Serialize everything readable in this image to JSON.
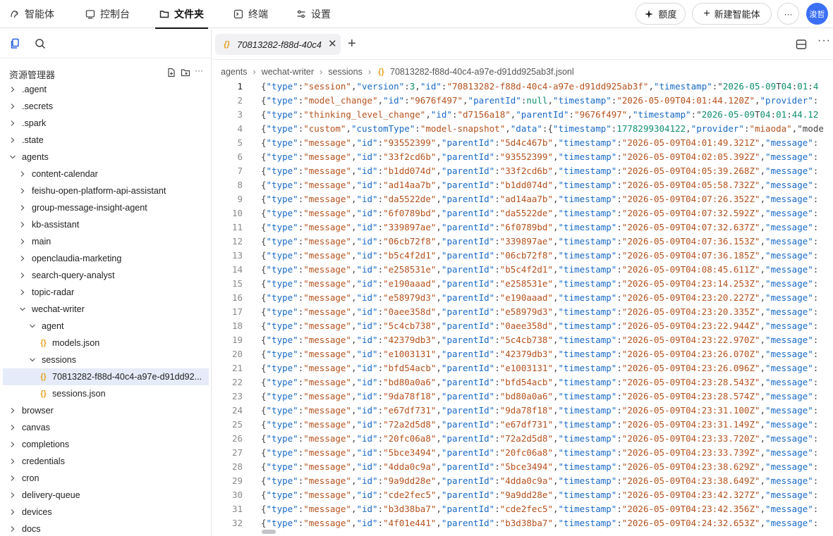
{
  "nav": {
    "tabs": [
      {
        "label": "智能体",
        "icon": "agent-icon"
      },
      {
        "label": "控制台",
        "icon": "console-icon"
      },
      {
        "label": "文件夹",
        "icon": "folder-icon",
        "active": true
      },
      {
        "label": "终端",
        "icon": "terminal-icon"
      },
      {
        "label": "设置",
        "icon": "settings-icon"
      }
    ],
    "quota_label": "额度",
    "new_agent_label": "新建智能体",
    "more_label": "···",
    "avatar_text": "浚哲"
  },
  "explorer": {
    "title": "资源管理器",
    "tree": [
      {
        "label": ".agent",
        "type": "folder",
        "depth": 0,
        "expanded": false
      },
      {
        "label": ".secrets",
        "type": "folder",
        "depth": 0,
        "expanded": false
      },
      {
        "label": ".spark",
        "type": "folder",
        "depth": 0,
        "expanded": false
      },
      {
        "label": ".state",
        "type": "folder",
        "depth": 0,
        "expanded": false
      },
      {
        "label": "agents",
        "type": "folder",
        "depth": 0,
        "expanded": true
      },
      {
        "label": "content-calendar",
        "type": "folder",
        "depth": 1,
        "expanded": false
      },
      {
        "label": "feishu-open-platform-api-assistant",
        "type": "folder",
        "depth": 1,
        "expanded": false
      },
      {
        "label": "group-message-insight-agent",
        "type": "folder",
        "depth": 1,
        "expanded": false
      },
      {
        "label": "kb-assistant",
        "type": "folder",
        "depth": 1,
        "expanded": false
      },
      {
        "label": "main",
        "type": "folder",
        "depth": 1,
        "expanded": false
      },
      {
        "label": "openclaudia-marketing",
        "type": "folder",
        "depth": 1,
        "expanded": false
      },
      {
        "label": "search-query-analyst",
        "type": "folder",
        "depth": 1,
        "expanded": false
      },
      {
        "label": "topic-radar",
        "type": "folder",
        "depth": 1,
        "expanded": false
      },
      {
        "label": "wechat-writer",
        "type": "folder",
        "depth": 1,
        "expanded": true
      },
      {
        "label": "agent",
        "type": "folder",
        "depth": 2,
        "expanded": true
      },
      {
        "label": "models.json",
        "type": "file",
        "depth": 3
      },
      {
        "label": "sessions",
        "type": "folder",
        "depth": 2,
        "expanded": true
      },
      {
        "label": "70813282-f88d-40c4-a97e-d91dd92...",
        "type": "file",
        "depth": 3,
        "selected": true
      },
      {
        "label": "sessions.json",
        "type": "file",
        "depth": 3
      },
      {
        "label": "browser",
        "type": "folder",
        "depth": 0,
        "expanded": false
      },
      {
        "label": "canvas",
        "type": "folder",
        "depth": 0,
        "expanded": false
      },
      {
        "label": "completions",
        "type": "folder",
        "depth": 0,
        "expanded": false
      },
      {
        "label": "credentials",
        "type": "folder",
        "depth": 0,
        "expanded": false
      },
      {
        "label": "cron",
        "type": "folder",
        "depth": 0,
        "expanded": false
      },
      {
        "label": "delivery-queue",
        "type": "folder",
        "depth": 0,
        "expanded": false
      },
      {
        "label": "devices",
        "type": "folder",
        "depth": 0,
        "expanded": false
      },
      {
        "label": "docs",
        "type": "folder",
        "depth": 0,
        "expanded": false
      }
    ]
  },
  "editor": {
    "tab_label": "70813282-f88d-40c4",
    "close_label": "✕",
    "add_label": "+",
    "more_label": "···",
    "breadcrumb": [
      "agents",
      "wechat-writer",
      "sessions",
      "70813282-f88d-40c4-a97e-d91dd925ab3f.jsonl"
    ],
    "lines": [
      "{\"type\":\"session\",\"version\":3,\"id\":\"70813282-f88d-40c4-a97e-d91dd925ab3f\",\"timestamp\":\"2026-05-09T04:01:4",
      "{\"type\":\"model_change\",\"id\":\"9676f497\",\"parentId\":null,\"timestamp\":\"2026-05-09T04:01:44.120Z\",\"provider\":",
      "{\"type\":\"thinking_level_change\",\"id\":\"d7156a18\",\"parentId\":\"9676f497\",\"timestamp\":\"2026-05-09T04:01:44.12",
      "{\"type\":\"custom\",\"customType\":\"model-snapshot\",\"data\":{\"timestamp\":1778299304122,\"provider\":\"miaoda\",\"mode",
      "{\"type\":\"message\",\"id\":\"93552399\",\"parentId\":\"5d4c467b\",\"timestamp\":\"2026-05-09T04:01:49.321Z\",\"message\":",
      "{\"type\":\"message\",\"id\":\"33f2cd6b\",\"parentId\":\"93552399\",\"timestamp\":\"2026-05-09T04:02:05.392Z\",\"message\":",
      "{\"type\":\"message\",\"id\":\"b1dd074d\",\"parentId\":\"33f2cd6b\",\"timestamp\":\"2026-05-09T04:05:39.268Z\",\"message\":",
      "{\"type\":\"message\",\"id\":\"ad14aa7b\",\"parentId\":\"b1dd074d\",\"timestamp\":\"2026-05-09T04:05:58.732Z\",\"message\":",
      "{\"type\":\"message\",\"id\":\"da5522de\",\"parentId\":\"ad14aa7b\",\"timestamp\":\"2026-05-09T04:07:26.352Z\",\"message\":",
      "{\"type\":\"message\",\"id\":\"6f0789bd\",\"parentId\":\"da5522de\",\"timestamp\":\"2026-05-09T04:07:32.592Z\",\"message\":",
      "{\"type\":\"message\",\"id\":\"339897ae\",\"parentId\":\"6f0789bd\",\"timestamp\":\"2026-05-09T04:07:32.637Z\",\"message\":",
      "{\"type\":\"message\",\"id\":\"06cb72f8\",\"parentId\":\"339897ae\",\"timestamp\":\"2026-05-09T04:07:36.153Z\",\"message\":",
      "{\"type\":\"message\",\"id\":\"b5c4f2d1\",\"parentId\":\"06cb72f8\",\"timestamp\":\"2026-05-09T04:07:36.185Z\",\"message\":",
      "{\"type\":\"message\",\"id\":\"e258531e\",\"parentId\":\"b5c4f2d1\",\"timestamp\":\"2026-05-09T04:08:45.611Z\",\"message\":",
      "{\"type\":\"message\",\"id\":\"e190aaad\",\"parentId\":\"e258531e\",\"timestamp\":\"2026-05-09T04:23:14.253Z\",\"message\":",
      "{\"type\":\"message\",\"id\":\"e58979d3\",\"parentId\":\"e190aaad\",\"timestamp\":\"2026-05-09T04:23:20.227Z\",\"message\":",
      "{\"type\":\"message\",\"id\":\"0aee358d\",\"parentId\":\"e58979d3\",\"timestamp\":\"2026-05-09T04:23:20.335Z\",\"message\":",
      "{\"type\":\"message\",\"id\":\"5c4cb738\",\"parentId\":\"0aee358d\",\"timestamp\":\"2026-05-09T04:23:22.944Z\",\"message\":",
      "{\"type\":\"message\",\"id\":\"42379db3\",\"parentId\":\"5c4cb738\",\"timestamp\":\"2026-05-09T04:23:22.970Z\",\"message\":",
      "{\"type\":\"message\",\"id\":\"e1003131\",\"parentId\":\"42379db3\",\"timestamp\":\"2026-05-09T04:23:26.070Z\",\"message\":",
      "{\"type\":\"message\",\"id\":\"bfd54acb\",\"parentId\":\"e1003131\",\"timestamp\":\"2026-05-09T04:23:26.096Z\",\"message\":",
      "{\"type\":\"message\",\"id\":\"bd80a0a6\",\"parentId\":\"bfd54acb\",\"timestamp\":\"2026-05-09T04:23:28.543Z\",\"message\":",
      "{\"type\":\"message\",\"id\":\"9da78f18\",\"parentId\":\"bd80a0a6\",\"timestamp\":\"2026-05-09T04:23:28.574Z\",\"message\":",
      "{\"type\":\"message\",\"id\":\"e67df731\",\"parentId\":\"9da78f18\",\"timestamp\":\"2026-05-09T04:23:31.100Z\",\"message\":",
      "{\"type\":\"message\",\"id\":\"72a2d5d8\",\"parentId\":\"e67df731\",\"timestamp\":\"2026-05-09T04:23:31.149Z\",\"message\":",
      "{\"type\":\"message\",\"id\":\"20fc06a8\",\"parentId\":\"72a2d5d8\",\"timestamp\":\"2026-05-09T04:23:33.720Z\",\"message\":",
      "{\"type\":\"message\",\"id\":\"5bce3494\",\"parentId\":\"20fc06a8\",\"timestamp\":\"2026-05-09T04:23:33.739Z\",\"message\":",
      "{\"type\":\"message\",\"id\":\"4dda0c9a\",\"parentId\":\"5bce3494\",\"timestamp\":\"2026-05-09T04:23:38.629Z\",\"message\":",
      "{\"type\":\"message\",\"id\":\"9a9dd28e\",\"parentId\":\"4dda0c9a\",\"timestamp\":\"2026-05-09T04:23:38.649Z\",\"message\":",
      "{\"type\":\"message\",\"id\":\"cde2fec5\",\"parentId\":\"9a9dd28e\",\"timestamp\":\"2026-05-09T04:23:42.327Z\",\"message\":",
      "{\"type\":\"message\",\"id\":\"b3d38ba7\",\"parentId\":\"cde2fec5\",\"timestamp\":\"2026-05-09T04:23:42.356Z\",\"message\":",
      "{\"type\":\"message\",\"id\":\"4f01e441\",\"parentId\":\"b3d38ba7\",\"timestamp\":\"2026-05-09T04:24:32.653Z\",\"message\":"
    ]
  },
  "colors": {
    "accent": "#3b6ff5",
    "selection": "#e6ebf9",
    "json_key": "#1769c6",
    "json_string": "#b5511c",
    "json_number": "#0e8f6e",
    "json_file_icon": "#e3a320"
  }
}
